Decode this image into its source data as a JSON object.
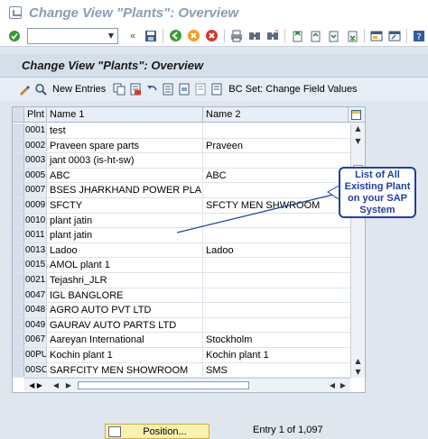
{
  "window": {
    "title": "Change View \"Plants\": Overview"
  },
  "header": {
    "title": "Change View \"Plants\": Overview"
  },
  "app_toolbar": {
    "new_entries": "New Entries",
    "bc_set": "BC Set: Change Field Values"
  },
  "table": {
    "columns": [
      "Plnt",
      "Name 1",
      "Name 2"
    ],
    "rows": [
      {
        "plnt": "0001",
        "name1": "test",
        "name2": ""
      },
      {
        "plnt": "0002",
        "name1": "Praveen spare parts",
        "name2": "Praveen"
      },
      {
        "plnt": "0003",
        "name1": "jant 0003 (is-ht-sw)",
        "name2": ""
      },
      {
        "plnt": "0005",
        "name1": "ABC",
        "name2": "ABC"
      },
      {
        "plnt": "0007",
        "name1": "BSES JHARKHAND POWER PLANT",
        "name2": ""
      },
      {
        "plnt": "0009",
        "name1": "SFCTY",
        "name2": "SFCTY MEN SHWROOM"
      },
      {
        "plnt": "0010",
        "name1": "plant jatin",
        "name2": ""
      },
      {
        "plnt": "0011",
        "name1": "plant jatin",
        "name2": ""
      },
      {
        "plnt": "0013",
        "name1": "Ladoo",
        "name2": "Ladoo"
      },
      {
        "plnt": "0015",
        "name1": "AMOL plant 1",
        "name2": ""
      },
      {
        "plnt": "0021",
        "name1": "Tejashri_JLR",
        "name2": ""
      },
      {
        "plnt": "0047",
        "name1": "IGL BANGLORE",
        "name2": ""
      },
      {
        "plnt": "0048",
        "name1": "AGRO AUTO PVT LTD",
        "name2": ""
      },
      {
        "plnt": "0049",
        "name1": "GAURAV AUTO PARTS LTD",
        "name2": ""
      },
      {
        "plnt": "0067",
        "name1": "Aareyan International",
        "name2": "Stockholm"
      },
      {
        "plnt": "00PU",
        "name1": "Kochin plant 1",
        "name2": "Kochin plant 1"
      },
      {
        "plnt": "00SC",
        "name1": "SARFCITY MEN SHOWROOM",
        "name2": "SMS"
      }
    ]
  },
  "callout": {
    "lines": [
      "List of All",
      "Existing Plant",
      "on your SAP",
      "System"
    ]
  },
  "footer": {
    "position_button": "Position...",
    "entry_text": "Entry 1 of 1,097"
  }
}
